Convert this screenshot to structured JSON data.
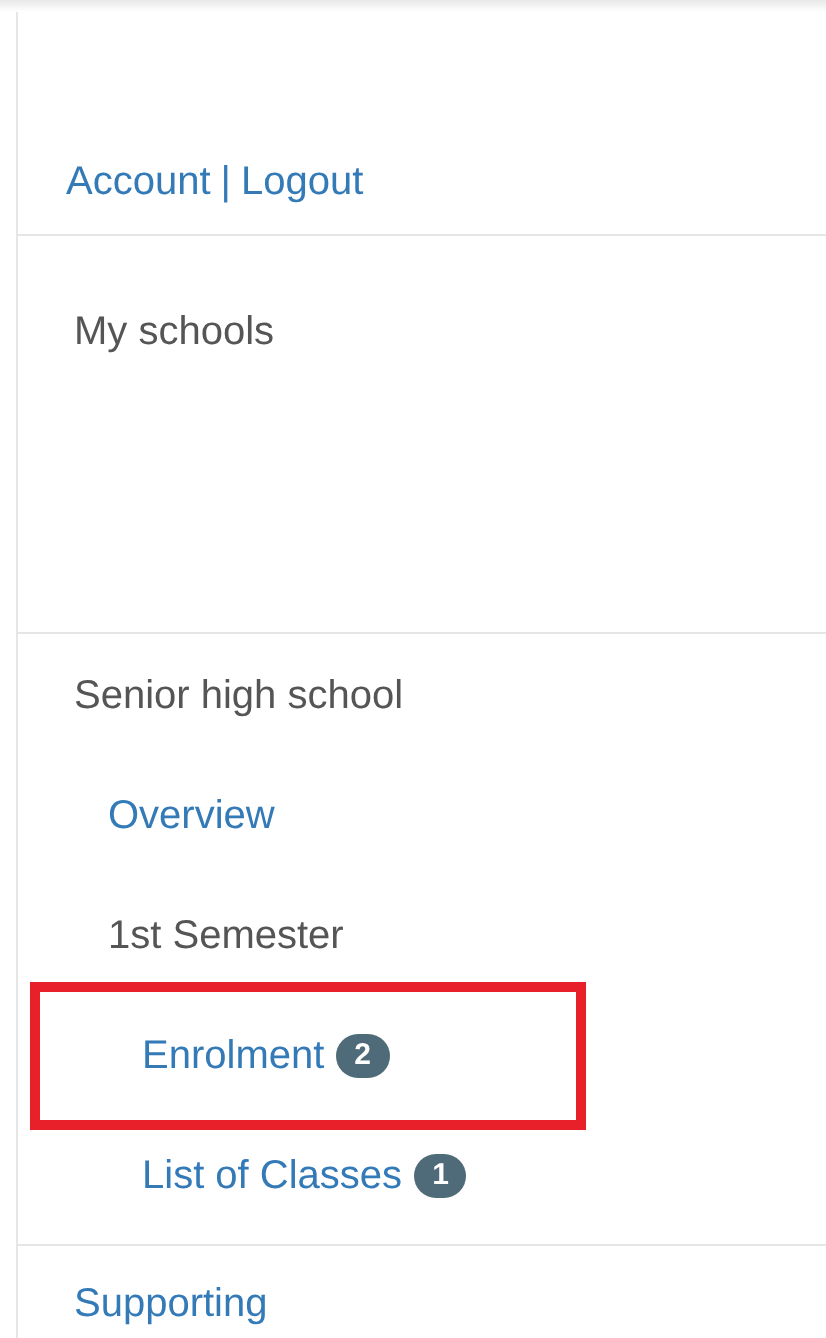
{
  "account_links": [
    {
      "label": "Account"
    },
    {
      "label": "Logout"
    }
  ],
  "account_separator": "|",
  "my_schools": {
    "label": "My schools"
  },
  "school_nav": [
    {
      "label": "Senior high school",
      "children": [
        {
          "label": "Overview"
        },
        {
          "label": "1st Semester",
          "children": [
            {
              "label": "Enrolment",
              "badge": "2",
              "highlighted": true
            },
            {
              "label": "List of Classes",
              "badge": "1",
              "highlighted": false
            }
          ]
        }
      ]
    }
  ],
  "bottom_link": {
    "label": "Supporting"
  }
}
